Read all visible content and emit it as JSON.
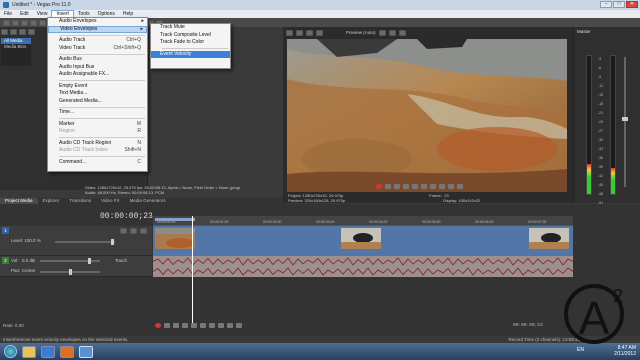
{
  "window": {
    "title": "Untitled * - Vegas Pro 11.0"
  },
  "menubar": [
    "File",
    "Edit",
    "View",
    "Insert",
    "Tools",
    "Options",
    "Help"
  ],
  "insert_menu": {
    "items": [
      {
        "label": "Audio Envelopes",
        "shortcut": "",
        "submenu": true
      },
      {
        "label": "Video Envelopes",
        "shortcut": "",
        "submenu": true,
        "highlighted": true
      },
      {
        "sep": true
      },
      {
        "label": "Audio Track",
        "shortcut": "Ctrl+Q"
      },
      {
        "label": "Video Track",
        "shortcut": "Ctrl+Shift+Q"
      },
      {
        "sep": true
      },
      {
        "label": "Audio Bus",
        "shortcut": ""
      },
      {
        "label": "Audio Input Bus",
        "shortcut": ""
      },
      {
        "label": "Audio Assignable FX...",
        "shortcut": ""
      },
      {
        "sep": true
      },
      {
        "label": "Empty Event",
        "shortcut": ""
      },
      {
        "label": "Text Media...",
        "shortcut": ""
      },
      {
        "label": "Generated Media...",
        "shortcut": ""
      },
      {
        "sep": true
      },
      {
        "label": "Time...",
        "shortcut": ""
      },
      {
        "sep": true
      },
      {
        "label": "Marker",
        "shortcut": "M"
      },
      {
        "label": "Region",
        "shortcut": "R",
        "disabled": true
      },
      {
        "sep": true
      },
      {
        "label": "Audio CD Track Region",
        "shortcut": "N"
      },
      {
        "label": "Audio CD Track Index",
        "shortcut": "Shift+N",
        "disabled": true
      },
      {
        "sep": true
      },
      {
        "label": "Command...",
        "shortcut": "C"
      }
    ]
  },
  "video_envelopes_submenu": [
    {
      "label": "Track Mute"
    },
    {
      "label": "Track Composite Level"
    },
    {
      "label": "Track Fade to Color"
    },
    {
      "sep": true
    },
    {
      "label": "Event Velocity",
      "highlighted": true
    }
  ],
  "explorer": {
    "tree": [
      "All Media",
      "Media Bins"
    ]
  },
  "media_info": {
    "video": "Video: 1280x720x12, 29.970 fps, 00:00:08.13, Alpha = None, Field Order = None (progr",
    "audio": "Audio: 48,000 Hz, Stereo, 00:00:08.13, PCM"
  },
  "panel_tabs": [
    "Project Media",
    "Explorer",
    "Transitions",
    "Video FX",
    "Media Generators"
  ],
  "preview": {
    "mode": "Preview (Auto)",
    "project": "Project: 1280x720x32, 29.970p",
    "preview_res": "Preview: 320x180x128, 29.970p",
    "display": "Display: 430x242x32",
    "frame_label": "Frame:",
    "frame": "23"
  },
  "master": {
    "title": "Master",
    "scale": [
      "-3",
      "-6",
      "-9",
      "-12",
      "-15",
      "-18",
      "-21",
      "-24",
      "-27",
      "-30",
      "-33",
      "-36",
      "-39",
      "-42",
      "-45",
      "-48",
      "-51",
      "-54",
      "-57"
    ]
  },
  "timeline": {
    "timecode": "00:00:00;23",
    "ruler_ticks": [
      "00:00:00;00",
      "00:00:01;00",
      "00:00:02;00",
      "00:00:03;00",
      "00:00:04;00",
      "00:00:05;00",
      "00:00:06;00",
      "00:00:07;00"
    ],
    "video_track": {
      "num": "1",
      "level_label": "Level: 100.0 %"
    },
    "audio_track": {
      "num": "2",
      "vol_label": "Vol:",
      "vol_value": "0.0 dB",
      "pan_label": "Pan:",
      "pan_value": "Center",
      "touch": "Touch"
    },
    "rate": "Rate: 0.00",
    "end_timecode": "00:00:00;23"
  },
  "status": {
    "left": "Insert/remove event velocity envelopes on the selected events.",
    "right": "Record Time (2 channels): 13:59:45"
  },
  "tray": {
    "lang": "EN",
    "time": "8:47 AM",
    "date": "2/11/2012"
  },
  "watermark": {
    "symbol": "A",
    "superscript": "2"
  },
  "colors": {
    "menu_highlight": "#3b82d6",
    "video_lane": "#5276a8",
    "audio_lane": "#9e8f8f",
    "track_video": "#3461a3",
    "track_audio": "#3a7d3a"
  },
  "icons": [
    "app-icon",
    "windows-start-icon",
    "speaker-icon",
    "play-icon",
    "stop-icon",
    "record-icon"
  ]
}
